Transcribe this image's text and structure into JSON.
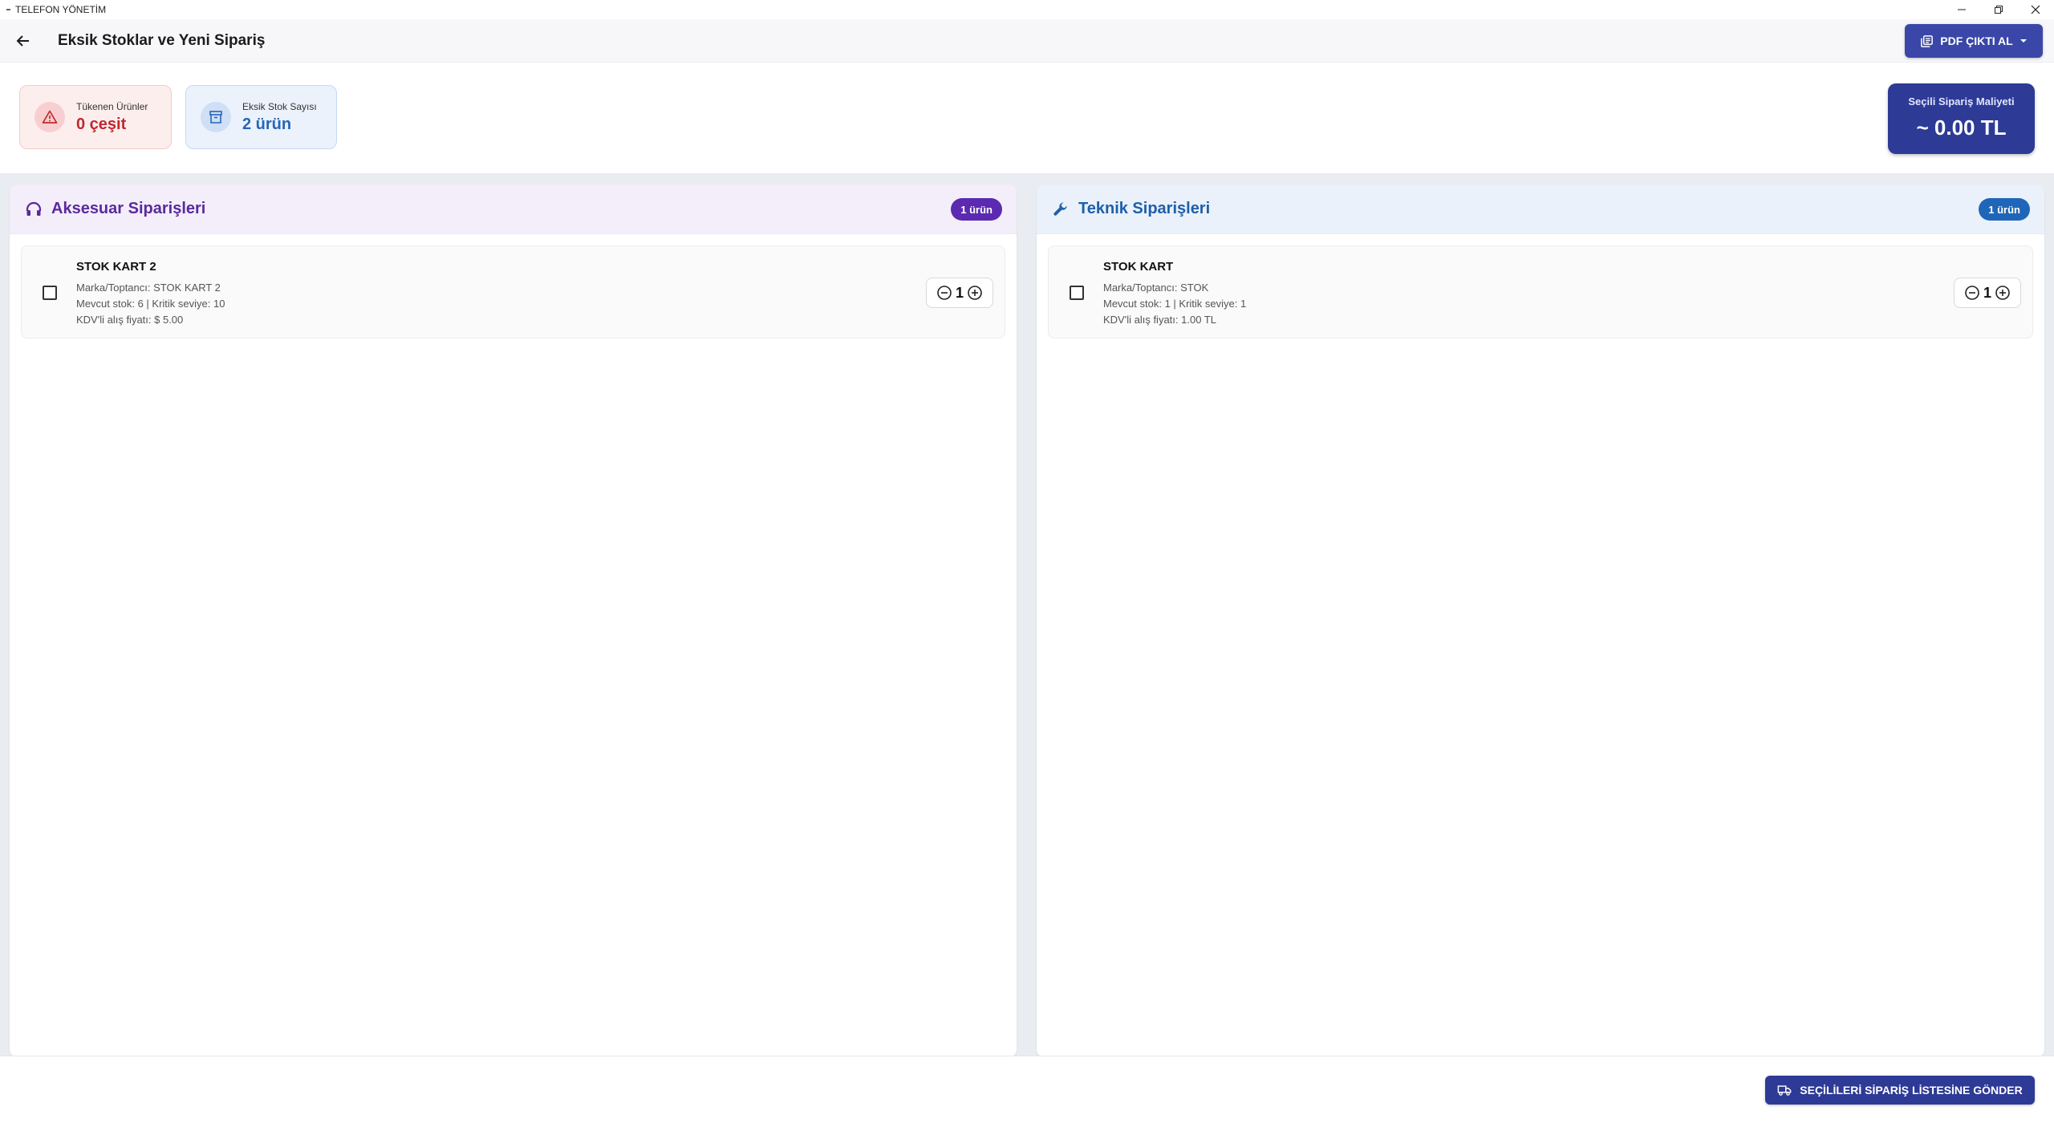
{
  "window": {
    "title": "TELEFON YÖNETİM",
    "controls": [
      "minimize-icon",
      "restore-icon",
      "close-icon"
    ]
  },
  "appbar": {
    "back_icon": "arrow-left-icon",
    "title": "Eksik Stoklar ve Yeni Sipariş",
    "pdf_button_label": "PDF ÇIKTI AL",
    "pdf_button_icon": "document-stack-icon"
  },
  "summary": {
    "out_of_stock": {
      "label": "Tükenen Ürünler",
      "value": "0 çeşit",
      "icon": "warning-triangle-icon"
    },
    "missing_stock": {
      "label": "Eksik Stok Sayısı",
      "value": "2 ürün",
      "icon": "archive-box-icon"
    },
    "cost": {
      "label": "Seçili Sipariş Maliyeti",
      "value": "~ 0.00 TL"
    }
  },
  "panels": {
    "accessory": {
      "title": "Aksesuar Siparişleri",
      "icon": "headphones-icon",
      "badge": "1 ürün",
      "items": [
        {
          "name": "STOK KART 2",
          "brand": "Marka/Toptancı: STOK KART 2",
          "stock": "Mevcut stok: 6 | Kritik seviye: 10",
          "price": "KDV'li alış fiyatı: $ 5.00",
          "quantity": "1",
          "checked": false
        }
      ]
    },
    "technical": {
      "title": "Teknik Siparişleri",
      "icon": "wrench-icon",
      "badge": "1 ürün",
      "items": [
        {
          "name": "STOK KART",
          "brand": "Marka/Toptancı: STOK",
          "stock": "Mevcut stok: 1 | Kritik seviye: 1",
          "price": "KDV'li alış fiyatı: 1.00 TL",
          "quantity": "1",
          "checked": false
        }
      ]
    }
  },
  "footer": {
    "send_button_label": "SEÇİLİLERİ SİPARİŞ LİSTESİNE GÖNDER",
    "send_button_icon": "truck-icon"
  },
  "colors": {
    "primary": "#3a47a8",
    "accessory_accent": "#5a2a9c",
    "technical_accent": "#1f5fa8",
    "danger": "#c0282d",
    "info": "#2766b8"
  }
}
